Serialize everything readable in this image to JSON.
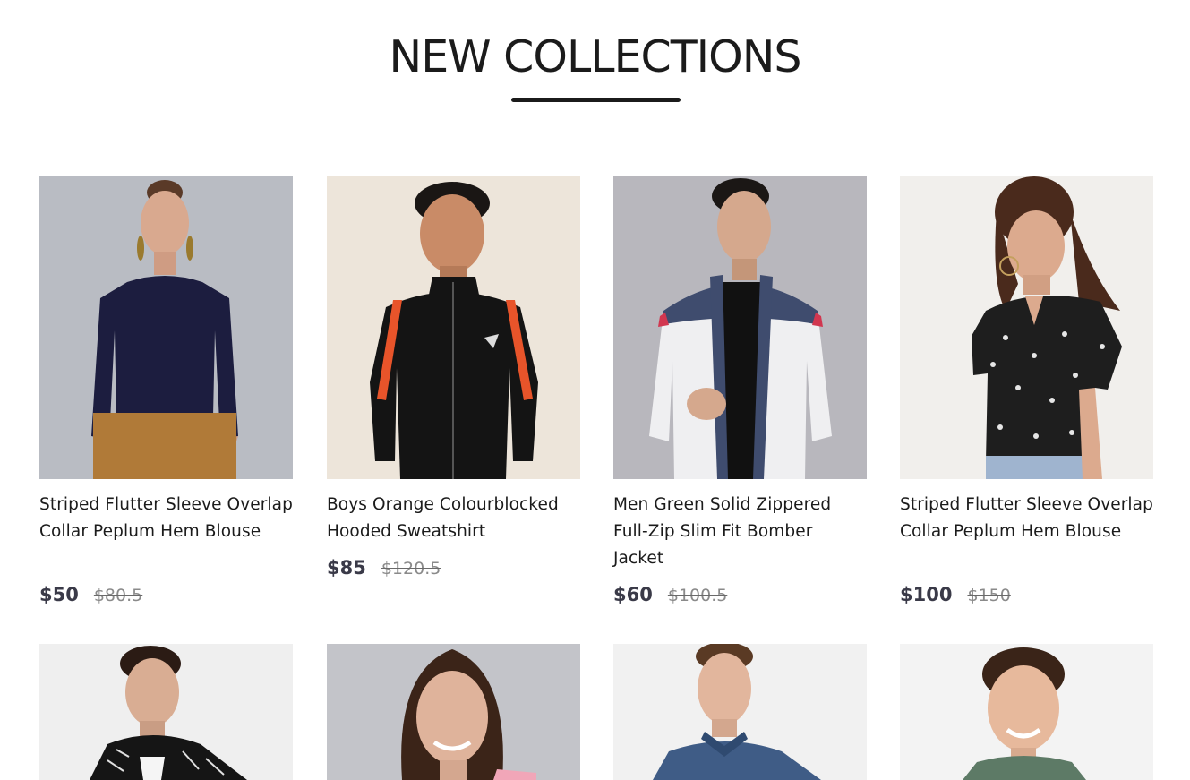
{
  "section": {
    "title": "NEW COLLECTIONS"
  },
  "products": [
    {
      "name": "Striped Flutter Sleeve Overlap Collar Peplum Hem Blouse",
      "price": "$50",
      "old_price": "$80.5",
      "image_bg": "#b9bcc3"
    },
    {
      "name": "Boys Orange Colourblocked Hooded Sweatshirt",
      "price": "$85",
      "old_price": "$120.5",
      "image_bg": "#ede5da"
    },
    {
      "name": "Men Green Solid Zippered Full-Zip Slim Fit Bomber Jacket",
      "price": "$60",
      "old_price": "$100.5",
      "image_bg": "#b8b7bd"
    },
    {
      "name": "Striped Flutter Sleeve Overlap Collar Peplum Hem Blouse",
      "price": "$100",
      "old_price": "$150",
      "image_bg": "#f1efec"
    },
    {
      "image_bg": "#efefef"
    },
    {
      "image_bg": "#c3c4c9"
    },
    {
      "image_bg": "#f1f1f1"
    },
    {
      "image_bg": "#f3f3f3"
    }
  ]
}
